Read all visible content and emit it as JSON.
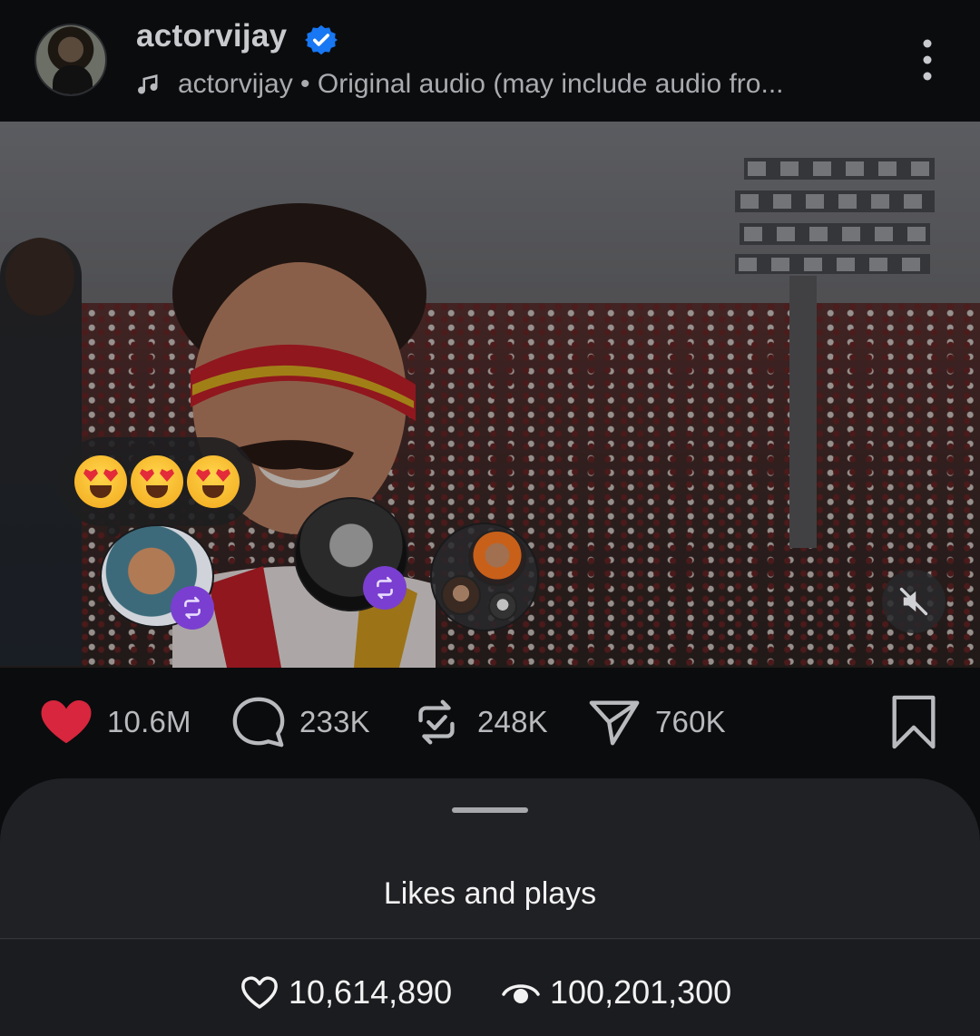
{
  "header": {
    "username": "actorvijay",
    "audio_text": "actorvijay • Original audio (may include audio fro..."
  },
  "icons": {
    "verified": "verified-badge-icon",
    "audio": "music-note-icon",
    "more": "more-vertical-icon",
    "like": "heart-filled-icon",
    "comment": "comment-icon",
    "repost": "repost-icon",
    "share": "send-icon",
    "save": "bookmark-icon",
    "mute": "muted-speaker-icon"
  },
  "reactions": {
    "emojis": [
      "😍",
      "😍",
      "😍"
    ]
  },
  "actions": {
    "likes": "10.6M",
    "comments": "233K",
    "reposts": "248K",
    "shares": "760K"
  },
  "sheet": {
    "title": "Likes and plays",
    "likes_count": "10,614,890",
    "plays_count": "100,201,300"
  },
  "colors": {
    "like_red": "#d7263d",
    "verified_blue": "#1877f2",
    "repost_purple": "#7a3fd0",
    "sheet_bg": "#202124"
  }
}
